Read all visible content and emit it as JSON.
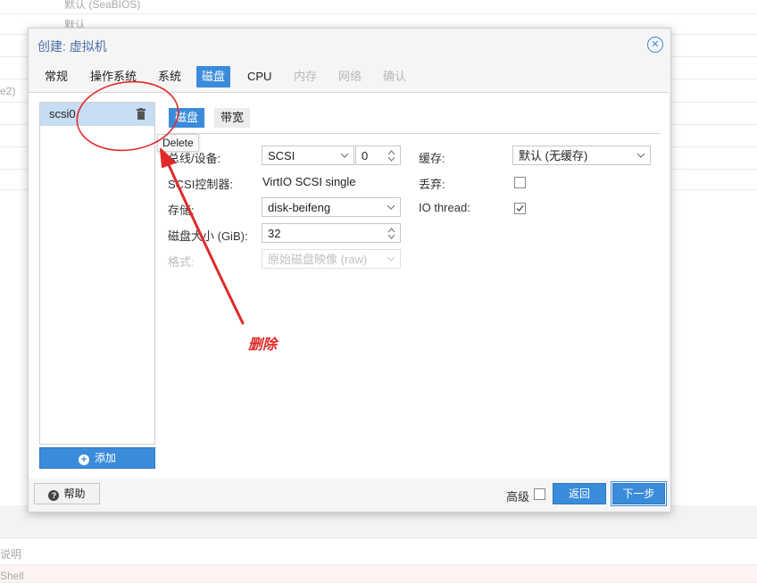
{
  "background": {
    "row1_text": "默认 (SeaBIOS)",
    "row2_text": "默认",
    "side_text": "e2)",
    "bottom1_text": "说明",
    "bottom2_text": "Shell"
  },
  "dialog": {
    "title": "创建: 虚拟机",
    "close_icon": "close-circle-icon",
    "tabs": [
      {
        "label": "常规",
        "state": "normal"
      },
      {
        "label": "操作系统",
        "state": "normal"
      },
      {
        "label": "系统",
        "state": "normal"
      },
      {
        "label": "磁盘",
        "state": "active"
      },
      {
        "label": "CPU",
        "state": "normal"
      },
      {
        "label": "内存",
        "state": "disabled"
      },
      {
        "label": "网络",
        "state": "disabled"
      },
      {
        "label": "确认",
        "state": "disabled"
      }
    ]
  },
  "device_list": {
    "items": [
      {
        "label": "scsi0",
        "selected": true
      }
    ],
    "delete_tooltip": "Delete",
    "add_button": "添加"
  },
  "disk_form": {
    "subtabs": [
      "磁盘",
      "带宽"
    ],
    "bus_label": "总线/设备:",
    "bus_value": "SCSI",
    "device_index": "0",
    "controller_label": "SCSI控制器:",
    "controller_value": "VirtIO SCSI single",
    "storage_label": "存储:",
    "storage_value": "disk-beifeng",
    "size_label": "磁盘大小 (GiB):",
    "size_value": "32",
    "format_label": "格式:",
    "format_value": "原始磁盘映像 (raw)",
    "cache_label": "缓存:",
    "cache_value": "默认 (无缓存)",
    "discard_label": "丢弃:",
    "discard_checked": false,
    "iothread_label": "IO thread:",
    "iothread_checked": true
  },
  "annotation": {
    "text": "删除",
    "color": "#e02a2a"
  },
  "footer": {
    "help": "帮助",
    "advanced": "高级",
    "advanced_checked": false,
    "back": "返回",
    "next": "下一步"
  },
  "colors": {
    "accent": "#3a8cdb",
    "selected_row": "#c7ddf3",
    "annotation": "#e02a2a"
  }
}
